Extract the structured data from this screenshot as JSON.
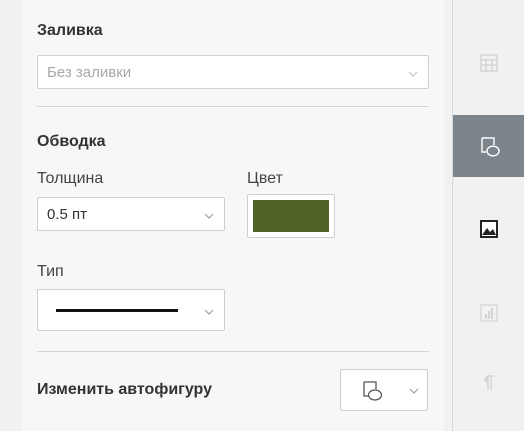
{
  "fill": {
    "label": "Заливка",
    "value": "Без заливки"
  },
  "stroke": {
    "label": "Обводка",
    "thickness_label": "Толщина",
    "thickness_value": "0.5 пт",
    "color_label": "Цвет",
    "color_value": "#4f6228",
    "type_label": "Тип"
  },
  "autoshape": {
    "label": "Изменить автофигуру"
  },
  "right_toolbar": {
    "items": [
      {
        "name": "table-settings",
        "icon": "table-icon",
        "state": "disabled"
      },
      {
        "name": "shape-settings",
        "icon": "shape-icon",
        "state": "active"
      },
      {
        "name": "image-settings",
        "icon": "image-icon",
        "state": "normal"
      },
      {
        "name": "chart-settings",
        "icon": "chart-icon",
        "state": "disabled"
      },
      {
        "name": "paragraph-settings",
        "icon": "paragraph-icon",
        "state": "disabled"
      }
    ]
  }
}
